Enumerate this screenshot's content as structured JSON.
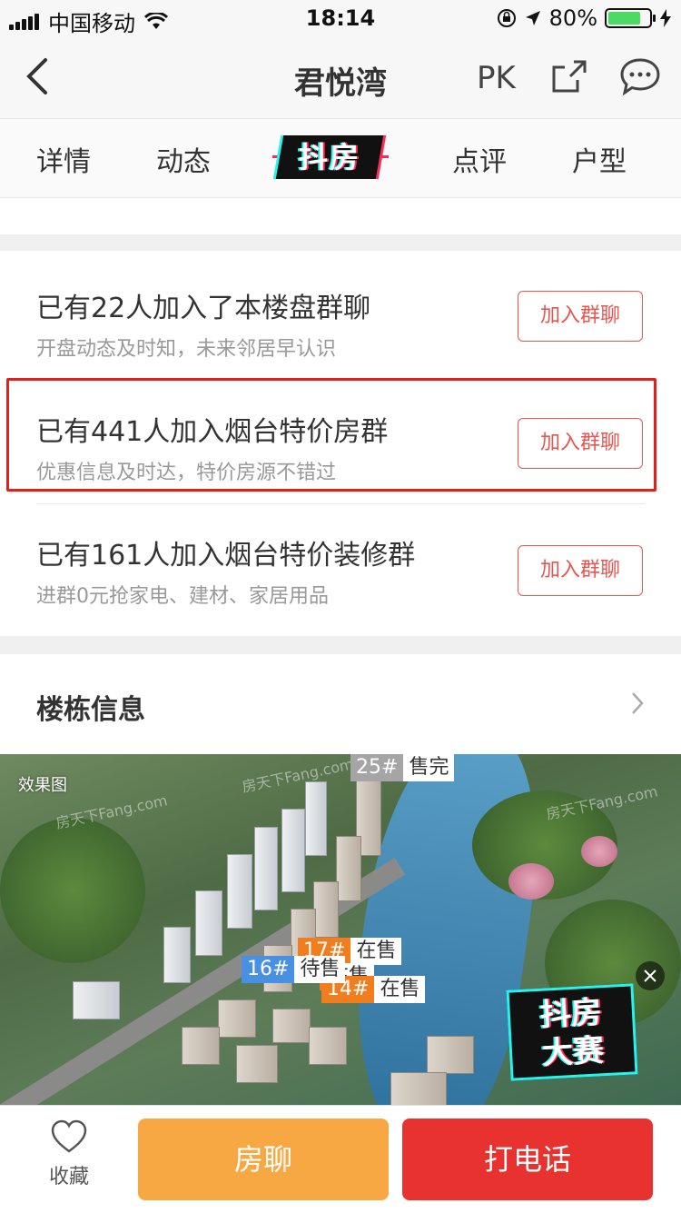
{
  "status_bar": {
    "carrier": "中国移动",
    "time": "18:14",
    "battery": "80%",
    "battery_level": 0.8
  },
  "nav": {
    "title": "君悦湾",
    "pk_label": "PK",
    "icons": [
      "back-icon",
      "share-icon",
      "chat-icon"
    ]
  },
  "tabs": {
    "items": [
      "详情",
      "动态",
      "抖房",
      "点评",
      "户型"
    ]
  },
  "groups": [
    {
      "title": "已有22人加入了本楼盘群聊",
      "subtitle": "开盘动态及时知，未来邻居早认识",
      "button": "加入群聊"
    },
    {
      "title": "已有441人加入烟台特价房群",
      "subtitle": "优惠信息及时达，特价房源不错过",
      "button": "加入群聊"
    },
    {
      "title": "已有161人加入烟台特价装修群",
      "subtitle": "进群0元抢家电、建材、家居用品",
      "button": "加入群聊"
    }
  ],
  "building": {
    "title": "楼栋信息",
    "photo_label": "效果图",
    "watermark": "房天下Fang.com",
    "tags": [
      {
        "num": "25#",
        "status": "售完"
      },
      {
        "num": "17#",
        "status": "在售"
      },
      {
        "num": "16#",
        "status": "待售"
      },
      {
        "num": "",
        "status": "在售"
      },
      {
        "num": "14#",
        "status": "在售"
      }
    ],
    "promo_text": [
      "抖房",
      "大赛"
    ]
  },
  "bottom": {
    "favorite_label": "收藏",
    "chat_button": "房聊",
    "call_button": "打电话"
  },
  "colors": {
    "accent_red": "#e8322f",
    "accent_orange": "#f7a842",
    "join_border": "#e8564f",
    "highlight_box": "#e0211b"
  }
}
